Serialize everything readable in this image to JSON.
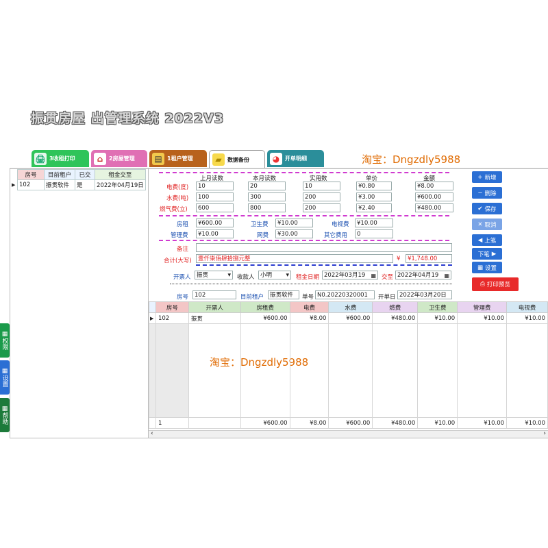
{
  "app": {
    "title": "振贯房屋    出管理系统  2022V3"
  },
  "watermark": "淘宝：Dngzdly5988",
  "tabs": [
    {
      "label": "3收租打印",
      "color": "#2fc45a",
      "icon": "printer-icon"
    },
    {
      "label": "2房屋管理",
      "color": "#e06fb4",
      "icon": "house-icon"
    },
    {
      "label": "1租户管理",
      "color": "#b8621c",
      "icon": "tenant-icon"
    },
    {
      "label": "数据备份",
      "color": "#ffffff",
      "icon": "folder-icon"
    },
    {
      "label": "开单明细",
      "color": "#2b8e9a",
      "icon": "pie-icon"
    }
  ],
  "left_grid": {
    "headers": [
      "房号",
      "目前租户",
      "已交",
      "租金交至"
    ],
    "rows": [
      [
        "102",
        "振贯软件",
        "是",
        "2022年04月19日"
      ]
    ]
  },
  "meter": {
    "col_headers": [
      "上月读数",
      "本月读数",
      "实用数",
      "单价",
      "金额"
    ],
    "rows": [
      {
        "label": "电费(度)",
        "prev": "10",
        "curr": "20",
        "used": "10",
        "price": "¥0.80",
        "amount": "¥8.00"
      },
      {
        "label": "水费(吨)",
        "prev": "100",
        "curr": "300",
        "used": "200",
        "price": "¥3.00",
        "amount": "¥600.00"
      },
      {
        "label": "燃气费(立)",
        "prev": "600",
        "curr": "800",
        "used": "200",
        "price": "¥2.40",
        "amount": "¥480.00"
      }
    ]
  },
  "fees": {
    "rent_label": "房租",
    "rent": "¥600.00",
    "sanitation_label": "卫生费",
    "sanitation": "¥10.00",
    "tv_label": "电视费",
    "tv": "¥10.00",
    "mgmt_label": "管理费",
    "mgmt": "¥10.00",
    "net_label": "网费",
    "net": "¥30.00",
    "other_label": "其它费用",
    "other": "0"
  },
  "remark": {
    "label": "备注",
    "value": ""
  },
  "total": {
    "label": "合计(大写)",
    "words": "壹仟柒佰肆拾捌元整",
    "currency": "¥",
    "amount": "¥1,748.00"
  },
  "billing": {
    "issuer_label": "开票人",
    "issuer": "振贯",
    "payee_label": "收款人",
    "payee": "小明",
    "rent_date_label": "租金日期",
    "rent_from": "2022年03月19",
    "to_label": "交至",
    "rent_to": "2022年04月19"
  },
  "bill_info": {
    "room_label": "房号",
    "room": "102",
    "tenant_label": "目前租户",
    "tenant": "振贯软件",
    "no_label": "单号",
    "no": "N0.20220320001",
    "date_label": "开单日",
    "date": "2022年03月20日"
  },
  "buttons": {
    "add": "新增",
    "delete": "删除",
    "save": "保存",
    "cancel": "取消",
    "prev": "上笔",
    "next": "下笔",
    "settings": "设置",
    "print_preview": "打印预览"
  },
  "bottom_grid": {
    "headers": [
      "房号",
      "开票人",
      "房租费",
      "电费",
      "水费",
      "燃费",
      "卫生费",
      "管理费",
      "电视费"
    ],
    "header_colors": [
      "#f3c6c6",
      "#cfe8c7",
      "#cfe8c7",
      "#f3c6c6",
      "#d4e8f4",
      "#e8d4f0",
      "#cfe8c7",
      "#e8d4f0",
      "#d4e8f4"
    ],
    "rows": [
      [
        "102",
        "振贯",
        "¥600.00",
        "¥8.00",
        "¥600.00",
        "¥480.00",
        "¥10.00",
        "¥10.00",
        "¥10.00"
      ]
    ],
    "footer": [
      "1",
      "",
      "¥600.00",
      "¥8.00",
      "¥600.00",
      "¥480.00",
      "¥10.00",
      "¥10.00",
      "¥10.00"
    ]
  },
  "side": {
    "permissions": "权限",
    "settings": "设置",
    "help": "帮助"
  }
}
